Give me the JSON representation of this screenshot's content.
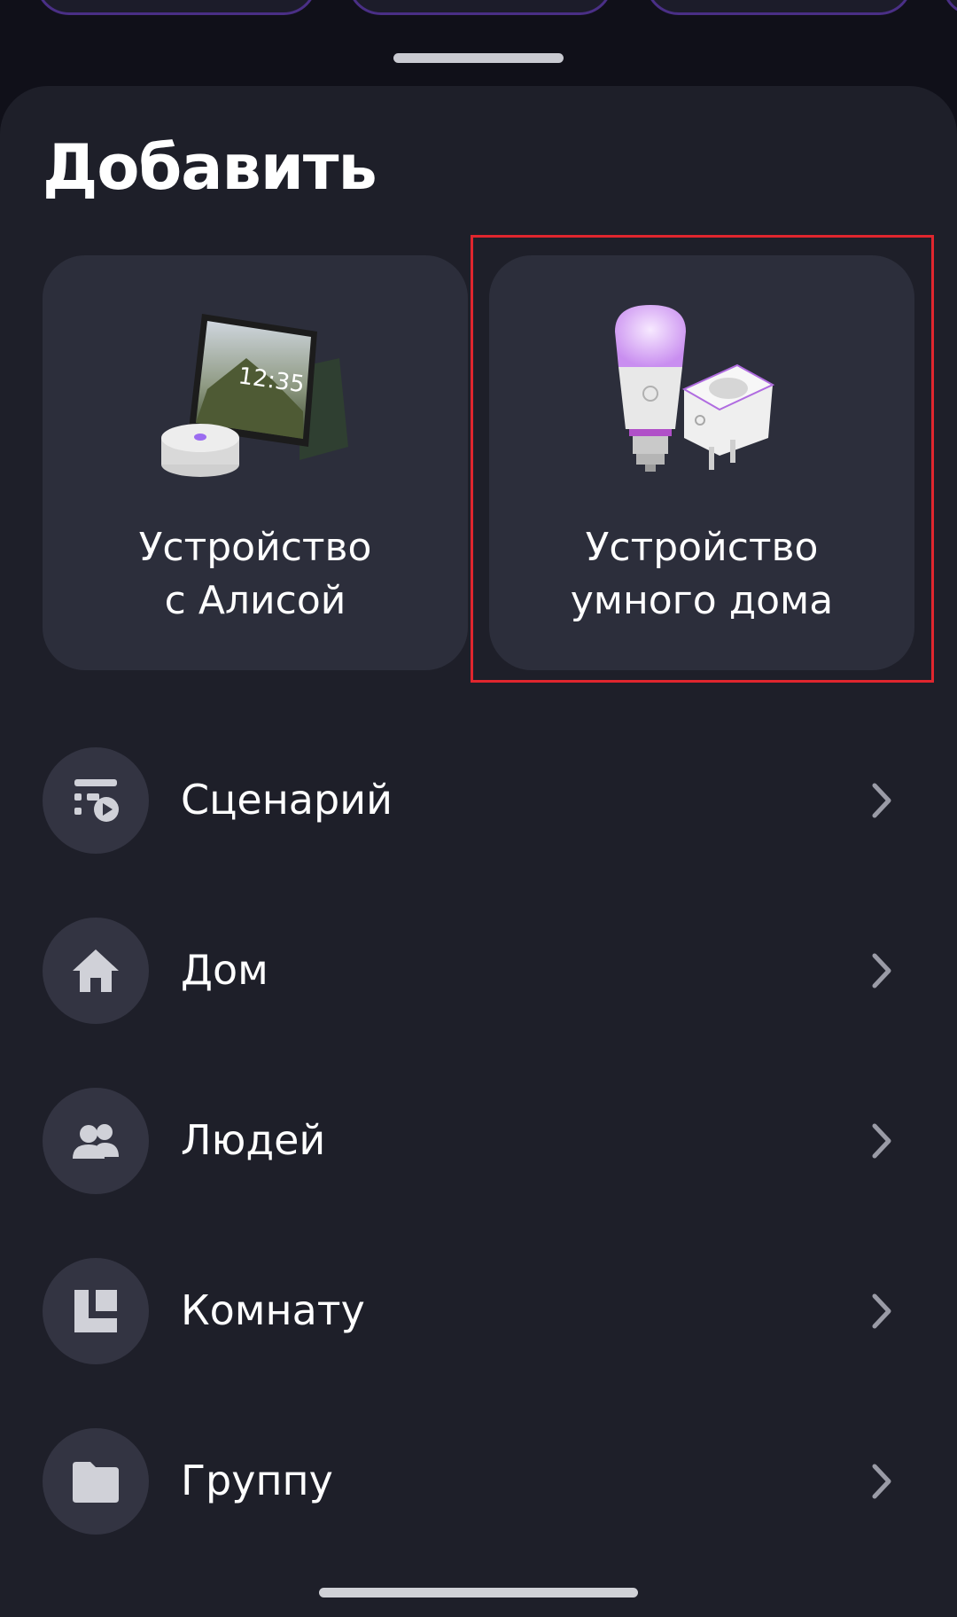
{
  "title": "Добавить",
  "cards": [
    {
      "id": "alice",
      "line1": "Устройство",
      "line2": "с Алисой",
      "image_text": "12:35"
    },
    {
      "id": "smarthome",
      "line1": "Устройство",
      "line2": "умного дома"
    }
  ],
  "menu": [
    {
      "label": "Сценарий",
      "icon": "scenario-icon"
    },
    {
      "label": "Дом",
      "icon": "home-icon"
    },
    {
      "label": "Людей",
      "icon": "people-icon"
    },
    {
      "label": "Комнату",
      "icon": "room-icon"
    },
    {
      "label": "Группу",
      "icon": "folder-icon"
    }
  ],
  "colors": {
    "background": "#101019",
    "sheet": "#1e1f29",
    "card": "#2c2e3b",
    "icon_circle": "#333442",
    "highlight": "#e0262e",
    "accent_purple": "#9b6cf0"
  }
}
